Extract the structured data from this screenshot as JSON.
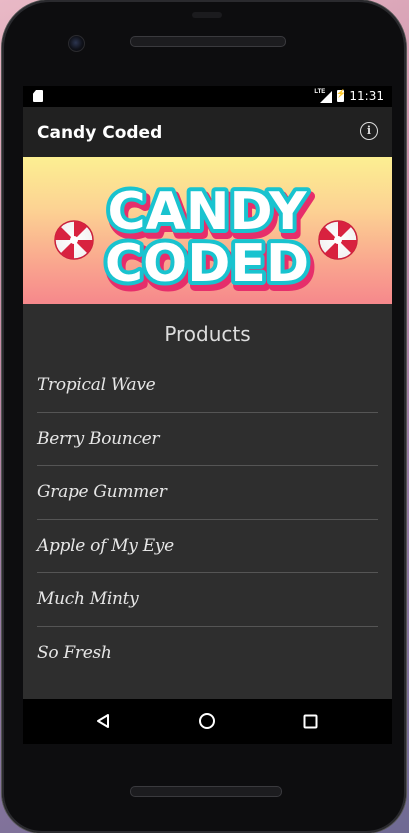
{
  "status_bar": {
    "time": "11:31",
    "icons": [
      "sd-card-icon",
      "lte-signal-icon",
      "battery-charging-icon"
    ],
    "network_label": "LTE"
  },
  "app_bar": {
    "title": "Candy Coded",
    "info_icon": "info-icon",
    "info_glyph": "i"
  },
  "banner": {
    "logo_line1": "CANDY",
    "logo_line2": "CODED"
  },
  "products": {
    "heading": "Products",
    "items": [
      "Tropical Wave",
      "Berry Bouncer",
      "Grape Gummer",
      "Apple of My Eye",
      "Much Minty",
      "So Fresh"
    ]
  },
  "nav_bar": {
    "buttons": [
      "back-icon",
      "home-icon",
      "recents-icon"
    ]
  },
  "colors": {
    "app_bar_bg": "#212121",
    "content_bg": "#2e2e2e",
    "banner_top": "#fcef92",
    "banner_bottom": "#f6888c",
    "logo_fill": "#ffffff",
    "logo_outline": "#19c3cf",
    "logo_shadow": "#e62e6b"
  }
}
